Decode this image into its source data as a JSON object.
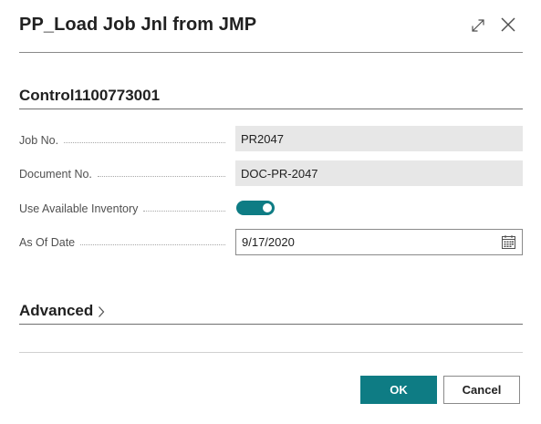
{
  "dialog": {
    "title": "PP_Load Job Jnl from JMP"
  },
  "section": {
    "title": "Control1100773001"
  },
  "fields": {
    "job_no": {
      "label": "Job No.",
      "value": "PR2047"
    },
    "document_no": {
      "label": "Document No.",
      "value": "DOC-PR-2047"
    },
    "use_available_inventory": {
      "label": "Use Available Inventory",
      "value": true
    },
    "as_of_date": {
      "label": "As Of Date",
      "value": "9/17/2020"
    }
  },
  "advanced": {
    "label": "Advanced"
  },
  "footer": {
    "ok_label": "OK",
    "cancel_label": "Cancel"
  },
  "colors": {
    "accent": "#0e7c84",
    "readonly_bg": "#e7e7e7"
  },
  "icons": [
    "expand-icon",
    "close-icon",
    "calendar-icon",
    "chevron-right-icon"
  ]
}
